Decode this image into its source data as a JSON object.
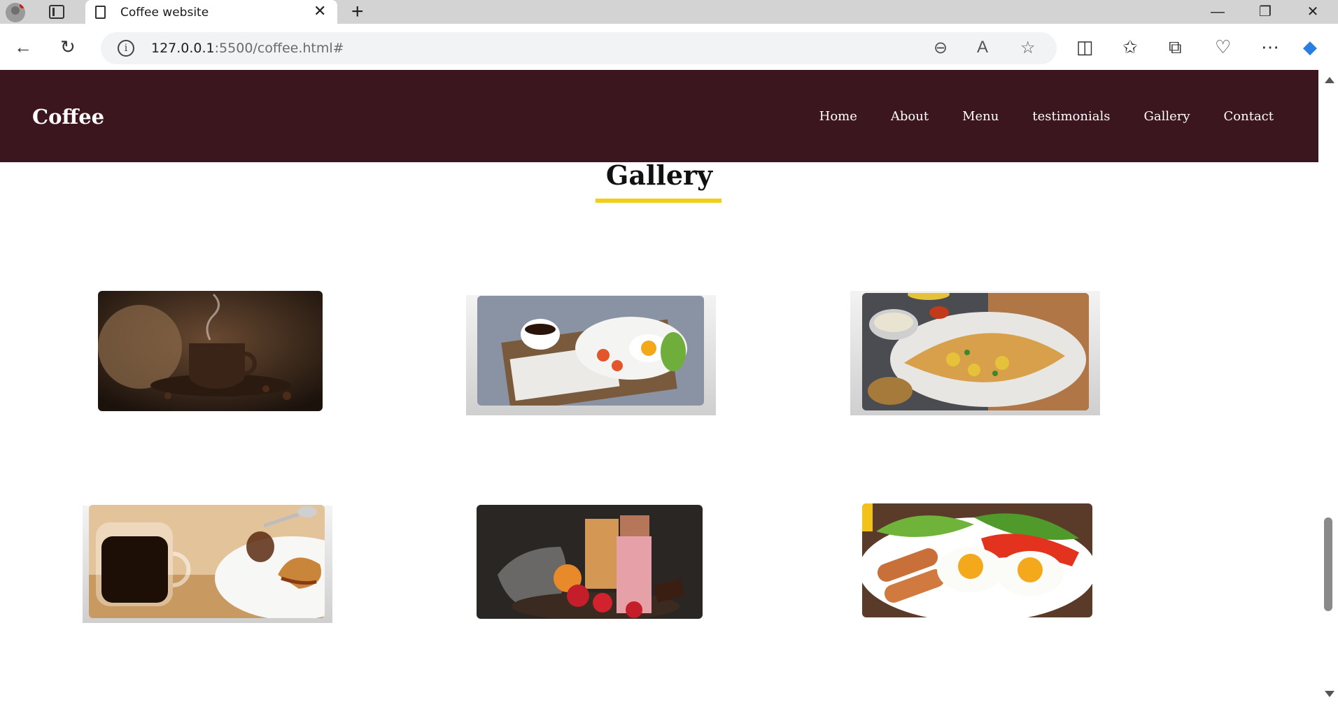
{
  "browser": {
    "tab_title": "Coffee website",
    "url_host": "127.0.0.1",
    "url_rest": ":5500/coffee.html#"
  },
  "site": {
    "logo": "Coffee",
    "nav": [
      "Home",
      "About",
      "Menu",
      "testimonials",
      "Gallery",
      "Contact"
    ],
    "accent": "#f0cf16",
    "header_bg": "#3c161f"
  },
  "gallery": {
    "title": "Gallery",
    "images": [
      "coffee-cup-on-beans",
      "breakfast-tray-egg-coffee",
      "masala-dosa-plate",
      "coffee-and-croissant",
      "fruit-milkshakes",
      "fried-eggs-sausages-vegetables"
    ]
  }
}
